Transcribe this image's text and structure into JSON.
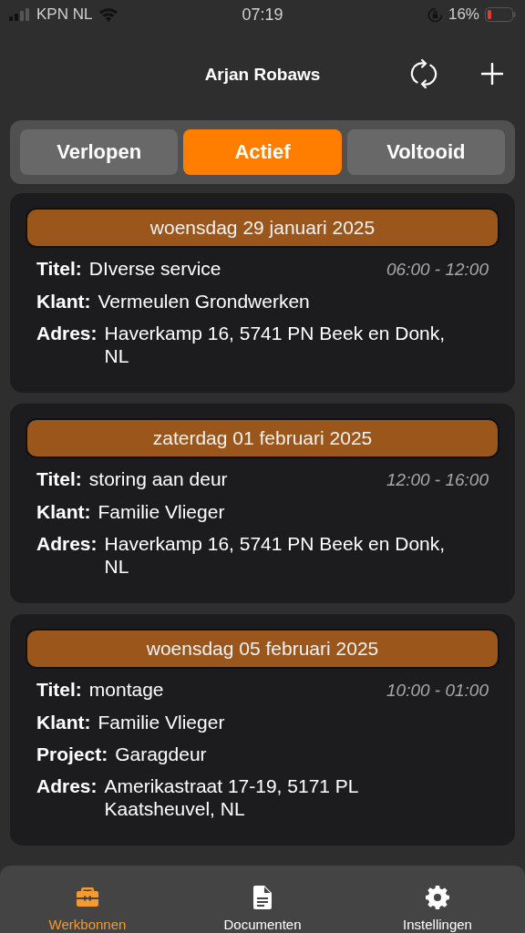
{
  "status_bar": {
    "carrier": "KPN NL",
    "time": "07:19",
    "battery": "16%"
  },
  "header": {
    "title": "Arjan Robaws"
  },
  "segments": [
    {
      "label": "Verlopen",
      "selected": false
    },
    {
      "label": "Actief",
      "selected": true
    },
    {
      "label": "Voltooid",
      "selected": false
    }
  ],
  "jobs": [
    {
      "date": "woensdag 29 januari 2025",
      "time": "06:00 - 12:00",
      "fields": [
        {
          "label": "Titel:",
          "value": "DIverse service"
        },
        {
          "label": "Klant:",
          "value": "Vermeulen Grondwerken"
        },
        {
          "label": "Adres:",
          "value": "Haverkamp 16, 5741 PN Beek en Donk, NL"
        }
      ]
    },
    {
      "date": "zaterdag 01 februari 2025",
      "time": "12:00 - 16:00",
      "fields": [
        {
          "label": "Titel:",
          "value": "storing aan deur"
        },
        {
          "label": "Klant:",
          "value": "Familie Vlieger"
        },
        {
          "label": "Adres:",
          "value": "Haverkamp 16, 5741 PN Beek en Donk, NL"
        }
      ]
    },
    {
      "date": "woensdag 05 februari 2025",
      "time": "10:00 - 01:00",
      "fields": [
        {
          "label": "Titel:",
          "value": "montage"
        },
        {
          "label": "Klant:",
          "value": "Familie Vlieger"
        },
        {
          "label": "Project:",
          "value": "Garagdeur"
        },
        {
          "label": "Adres:",
          "value": "Amerikastraat 17-19, 5171 PL Kaatsheuvel, NL"
        }
      ]
    }
  ],
  "tab_bar": [
    {
      "kind": "toolbox",
      "label": "Werkbonnen",
      "selected": true
    },
    {
      "kind": "document",
      "label": "Documenten",
      "selected": false
    },
    {
      "kind": "gear",
      "label": "Instellingen",
      "selected": false
    }
  ]
}
